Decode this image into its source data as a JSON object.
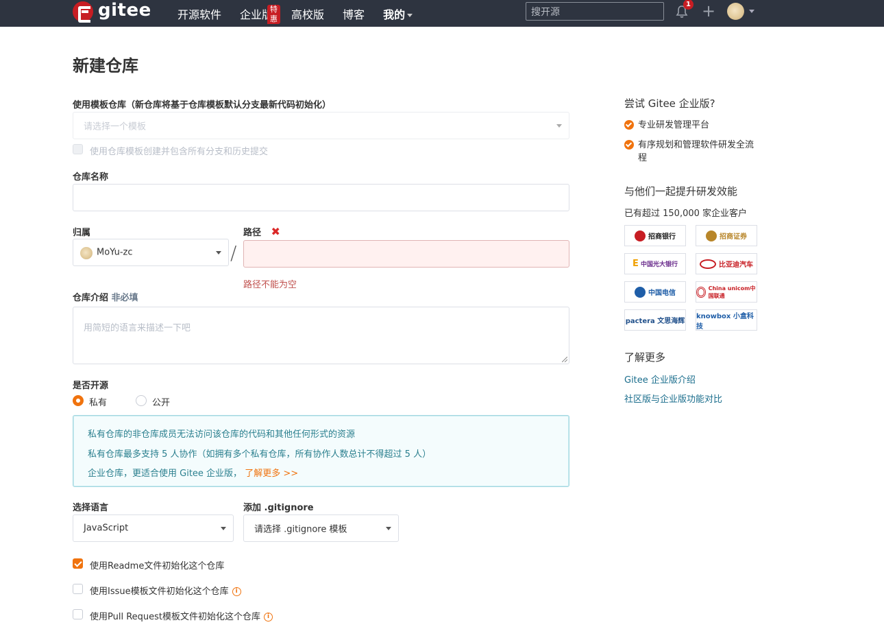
{
  "header": {
    "logo_text": "gitee",
    "nav": [
      {
        "label": "开源软件"
      },
      {
        "label": "企业版",
        "badge": "特惠"
      },
      {
        "label": "高校版"
      },
      {
        "label": "博客"
      },
      {
        "label": "我的"
      }
    ],
    "search_placeholder": "搜开源",
    "notification_count": "1",
    "plus_symbol": "+"
  },
  "page": {
    "title": "新建仓库"
  },
  "template": {
    "label": "使用模板仓库（新仓库将基于仓库模板默认分支最新代码初始化）",
    "placeholder": "请选择一个模板",
    "include_all_label": "使用仓库模板创建并包含所有分支和历史提交"
  },
  "repo_name": {
    "label": "仓库名称",
    "value": ""
  },
  "owner": {
    "label": "归属",
    "value": "MoYu-zc"
  },
  "path": {
    "label": "路径",
    "error_icon": "✖",
    "error": "路径不能为空",
    "separator": "/"
  },
  "description": {
    "label": "仓库介绍",
    "optional": "非必填",
    "placeholder": "用简短的语言来描述一下吧"
  },
  "visibility": {
    "label": "是否开源",
    "options": [
      {
        "label": "私有",
        "selected": true
      },
      {
        "label": "公开",
        "selected": false
      }
    ],
    "notice": [
      "私有仓库的非仓库成员无法访问该仓库的代码和其他任何形式的资源",
      "私有仓库最多支持 5 人协作（如拥有多个私有仓库，所有协作人数总计不得超过 5 人）",
      "企业仓库，更适合使用 Gitee 企业版，"
    ],
    "notice_link": "了解更多 >>"
  },
  "language": {
    "label": "选择语言",
    "value": "JavaScript"
  },
  "gitignore": {
    "label": "添加 .gitignore",
    "value": "请选择 .gitignore 模板"
  },
  "init_options": [
    {
      "label": "使用Readme文件初始化这个仓库",
      "checked": true,
      "info": false
    },
    {
      "label": "使用Issue模板文件初始化这个仓库",
      "checked": false,
      "info": true
    },
    {
      "label": "使用Pull Request模板文件初始化这个仓库",
      "checked": false,
      "info": true
    }
  ],
  "sidebar": {
    "try_title": "尝试 Gitee 企业版?",
    "features": [
      "专业研发管理平台",
      "有序规划和管理软件研发全流程"
    ],
    "together_title": "与他们一起提升研发效能",
    "customers_text": "已有超过 150,000 家企业客户",
    "customer_logos": [
      {
        "name": "招商银行",
        "color": "#c71d23"
      },
      {
        "name": "招商证券",
        "color": "#b8862a"
      },
      {
        "name": "中国光大银行",
        "color": "#6a2c8c"
      },
      {
        "name": "比亚迪汽车",
        "color": "#c71d23"
      },
      {
        "name": "中国电信",
        "color": "#1f5ea8"
      },
      {
        "name": "China unicom中国联通",
        "color": "#c71d23"
      },
      {
        "name": "pactera 文思海辉",
        "color": "#1f4f8a"
      },
      {
        "name": "knowbox 小盒科技",
        "color": "#1f5ea8"
      }
    ],
    "learn_more_title": "了解更多",
    "links": [
      "Gitee 企业版介绍",
      "社区版与企业版功能对比"
    ]
  },
  "colors": {
    "accent": "#f0730e",
    "brand": "#c71d23",
    "header_bg": "#2e3440",
    "link": "#1a6d8c"
  }
}
